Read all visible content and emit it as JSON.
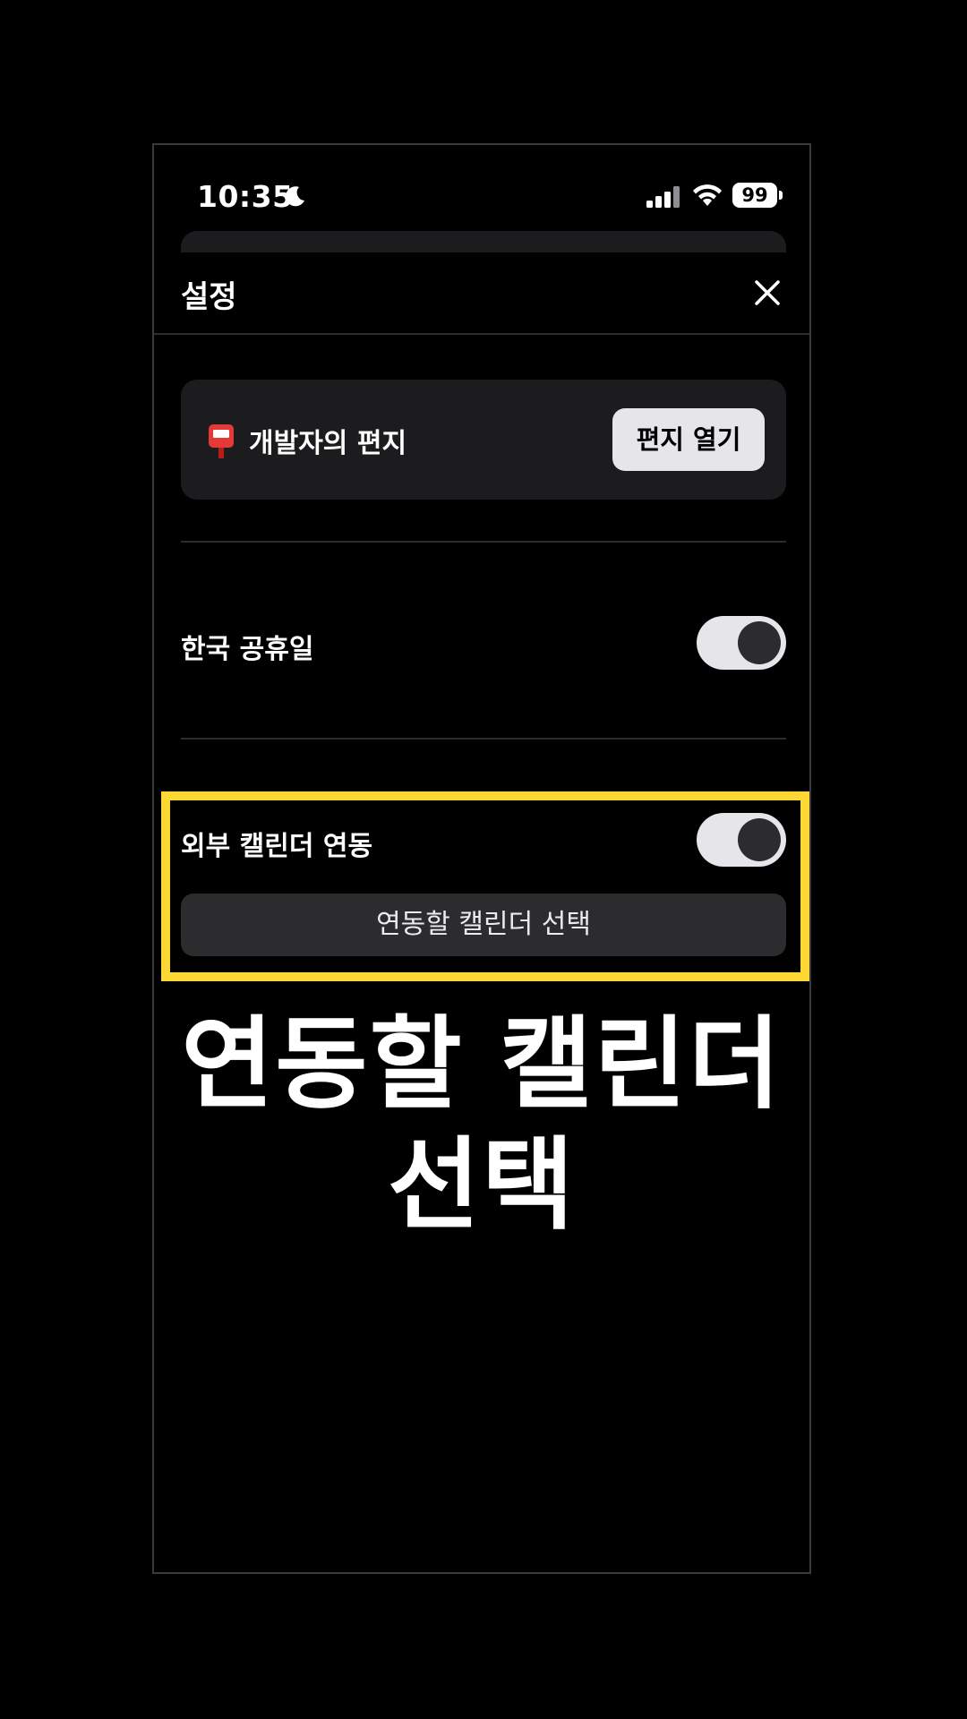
{
  "status_bar": {
    "time": "10:35",
    "battery_level": "99",
    "icons": [
      "moon-icon",
      "signal-icon",
      "wifi-icon",
      "battery-icon"
    ]
  },
  "header": {
    "title": "설정",
    "close_icon": "close-icon"
  },
  "letter_card": {
    "icon": "mailbox-icon",
    "label": "개발자의 편지",
    "button_label": "편지 열기"
  },
  "settings": {
    "korean_holidays": {
      "label": "한국 공휴일",
      "enabled": true
    },
    "external_calendar": {
      "label": "외부 캘린더 연동",
      "enabled": true,
      "select_button_label": "연동할 캘린더 선택"
    }
  },
  "colors": {
    "background": "#000000",
    "card": "#1c1c1e",
    "highlight": "#fdd835",
    "toggle_track": "#e5e5ea",
    "toggle_knob": "#2c2c2e"
  },
  "caption": {
    "line1": "연동할 캘린더",
    "line2": "선택"
  }
}
